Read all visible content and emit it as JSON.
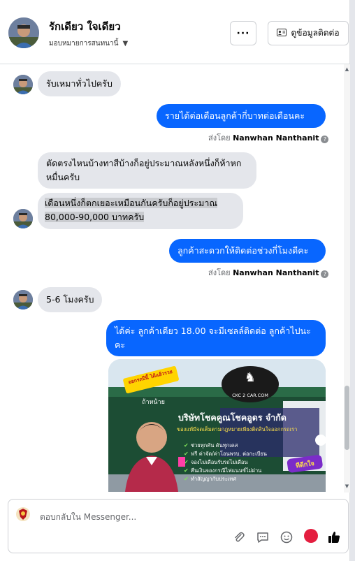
{
  "header": {
    "name": "รักเดียว ใจเดียว",
    "assign_label": "มอบหมายการสนทนานี้",
    "more_label": "···",
    "contact_label": "ดูข้อมูลติดต่อ"
  },
  "messages": {
    "m1": "รับเหมาทั่วไปครับ",
    "m2": "รายได้ต่อเดือนลูกค้ากี่บาทต่อเดือนคะ",
    "m2_sent_prefix": "ส่งโดย",
    "m2_sender": "Nanwhan Nanthanit",
    "m3": "ตัดตรงไหนบ้างทาสีบ้างก็อยู่ประมาณหลังหนึ่งก็ห้าหกหมื่นครับ",
    "m4_line1": "เดือนหนึ่งก็ตกเยอะเหมือนกันครับก็อยู่ประมาณ",
    "m4_line2": "80,000-90,000 บาทครับ",
    "m5": "ลูกค้าสะดวกให้ติดต่อช่วงกี่โมงดีคะ",
    "m5_sent_prefix": "ส่งโดย",
    "m5_sender": "Nanwhan Nanthanit",
    "m6": "5-6 โมงครับ",
    "m7": "ได้ค่ะ ลูกค้าเดียว 18.00 จะมีเซลล์ติดต่อ ลูกค้าไปนะคะ"
  },
  "ad": {
    "logo_text": "CKC 2 CAR.COM",
    "company": "บริษัทโชคคูณโชคอูดร จำกัด",
    "tagline": "ของแท้มีจดเต็มตามกฎหมายเพียงติดสินใจออกกรถเรา",
    "sticker": "ออกรถปีนี้ ได้แล้วรวย",
    "sign": "ถ้าหน้าย",
    "bullets": [
      "ช่วยทุกคัน ดันทุกเคส",
      "ฟรี ค่าจัด/ค่าโอนพรบ. ต่อกะเบียน",
      "จองไม่เดือนรับรถไม่เดือน",
      "คืนเงินจองกรณีไฟแนนซ์ไม่ผ่าน",
      "ทำสัญญากับประเทศ"
    ],
    "corner_badge": "ทีดีกใจ"
  },
  "composer": {
    "placeholder": "ตอบกลับใน Messenger..."
  },
  "colors": {
    "outgoing": "#0866ff",
    "incoming": "#e4e6eb"
  }
}
